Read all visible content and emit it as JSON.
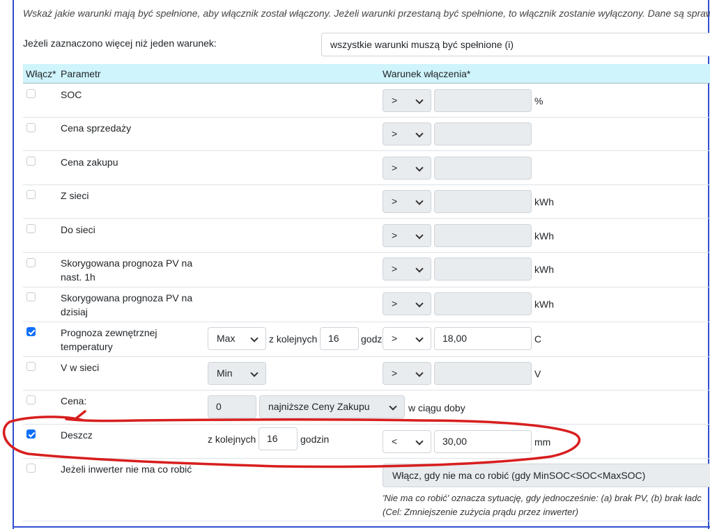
{
  "instructions": "Wskaż jakie warunki mają być spełnione, aby włącznik został włączony. Jeżeli warunki przestaną być spełnione, to włącznik zostanie wyłączony. Dane są sprawdzan",
  "mode": {
    "label": "Jeżeli zaznaczono więcej niż jeden warunek:",
    "value": "wszystkie warunki muszą być spełnione (i)"
  },
  "table": {
    "col_enable": "Włącz*",
    "col_param": "Parametr",
    "col_condition": "Warunek włączenia*"
  },
  "rows": {
    "soc": {
      "name": "SOC",
      "op": ">",
      "value": "",
      "unit": "%"
    },
    "cena_sprzedazy": {
      "name": "Cena sprzedaży",
      "op": ">",
      "value": ""
    },
    "cena_zakupu": {
      "name": "Cena zakupu",
      "op": ">",
      "value": ""
    },
    "z_sieci": {
      "name": "Z sieci",
      "op": ">",
      "value": "",
      "unit": "kWh"
    },
    "do_sieci": {
      "name": "Do sieci",
      "op": ">",
      "value": "",
      "unit": "kWh"
    },
    "pv_1h": {
      "name": "Skorygowana prognoza PV na nast. 1h",
      "op": ">",
      "value": "",
      "unit": "kWh"
    },
    "pv_dzis": {
      "name": "Skorygowana prognoza PV na dzisiaj",
      "op": ">",
      "value": "",
      "unit": "kWh"
    },
    "temp": {
      "name": "Prognoza zewnętrznej temperatury",
      "agg": "Max",
      "consec_label": "z kolejnych",
      "hours": "16",
      "hours_label": "godz",
      "op": ">",
      "value": "18,00",
      "unit": "C"
    },
    "v_sieci": {
      "name": "V w sieci",
      "agg": "Min",
      "op": ">",
      "value": "",
      "unit": "V"
    },
    "cena": {
      "name": "Cena:",
      "count": "0",
      "kind": "najniższe Ceny Zakupu",
      "suffix": "w ciągu doby"
    },
    "deszcz": {
      "name": "Deszcz",
      "consec_label": "z kolejnych",
      "hours": "16",
      "hours_label": "godzin",
      "op": "<",
      "value": "30,00",
      "unit": "mm"
    },
    "idle": {
      "name": "Jeżeli inwerter nie ma co robić",
      "value": "Włącz, gdy nie ma co robić (gdy MinSOC<SOC<MaxSOC)",
      "note1": "'Nie ma co robić' oznacza sytuację, gdy jednocześnie: (a) brak PV, (b) brak ładc",
      "note2": "(Cel: Zmniejszenie zużycia prądu przez inwerter)"
    }
  },
  "checked": {
    "temp": true,
    "deszcz": true
  },
  "colors": {
    "header_bg": "#cff4fc",
    "checkbox_on": "#0d6efd",
    "frame": "#2e4fd0",
    "annotation": "#d81e1e"
  }
}
